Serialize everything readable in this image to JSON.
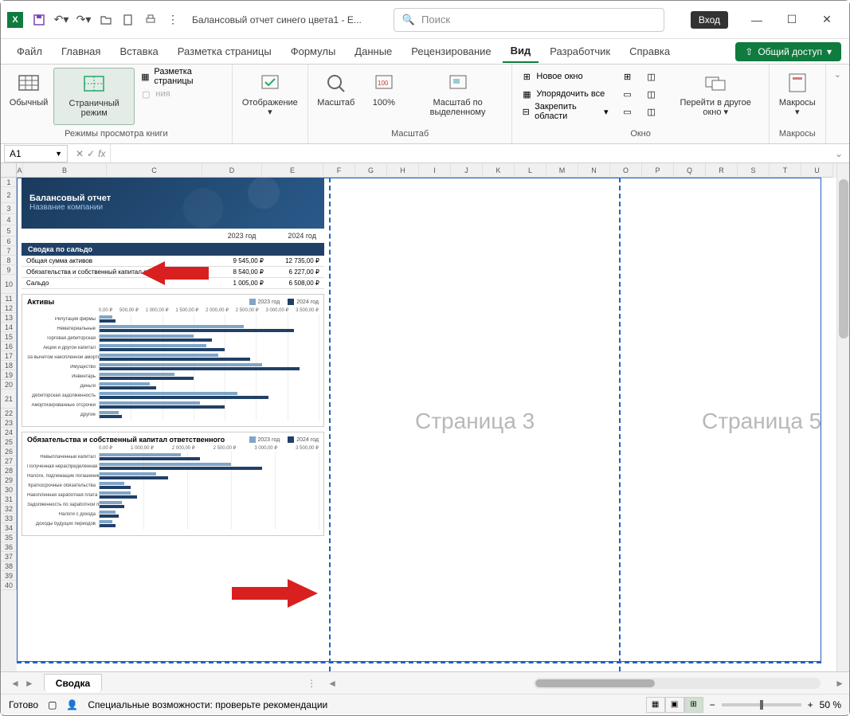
{
  "titlebar": {
    "doc_title": "Балансовый отчет синего цвета1 - E...",
    "search_placeholder": "Поиск",
    "login": "Вход"
  },
  "tabs": {
    "file": "Файл",
    "home": "Главная",
    "insert": "Вставка",
    "page_layout": "Разметка страницы",
    "formulas": "Формулы",
    "data": "Данные",
    "review": "Рецензирование",
    "view": "Вид",
    "developer": "Разработчик",
    "help": "Справка",
    "share": "Общий доступ"
  },
  "ribbon": {
    "normal": "Обычный",
    "page_break": "Страничный режим",
    "page_layout_btn": "Разметка страницы",
    "custom_views": "ния",
    "group_views": "Режимы просмотра книги",
    "show": "Отображение",
    "zoom": "Масштаб",
    "zoom100": "100%",
    "zoom_selection": "Масштаб по выделенному",
    "group_zoom": "Масштаб",
    "new_window": "Новое окно",
    "arrange": "Упорядочить все",
    "freeze": "Закрепить области",
    "group_window": "Окно",
    "switch": "Перейти в другое окно",
    "macros": "Макросы",
    "group_macros": "Макросы"
  },
  "namebox": "A1",
  "columns": [
    "A",
    "B",
    "C",
    "D",
    "E",
    "F",
    "G",
    "H",
    "I",
    "J",
    "K",
    "L",
    "M",
    "N",
    "O",
    "P",
    "Q",
    "R",
    "S",
    "T",
    "U"
  ],
  "rows": [
    "1",
    "2",
    "3",
    "4",
    "5",
    "6",
    "7",
    "8",
    "9",
    "10",
    "11",
    "12",
    "13",
    "14",
    "15",
    "16",
    "17",
    "18",
    "19",
    "20",
    "21",
    "22",
    "23",
    "24",
    "25",
    "26",
    "27",
    "28",
    "29",
    "30",
    "31",
    "32",
    "33",
    "34",
    "35",
    "36",
    "37",
    "38",
    "39",
    "40"
  ],
  "page_wm": {
    "p3": "Страница 3",
    "p5": "Страница 5"
  },
  "report": {
    "title": "Балансовый отчет",
    "subtitle": "Название компании",
    "year1": "2023 год",
    "year2": "2024 год",
    "section1": "Сводка по сальдо",
    "rows1": [
      {
        "l": "Общая сумма активов",
        "v1": "9 545,00 ₽",
        "v2": "12 735,00 ₽"
      },
      {
        "l": "Обязательства и собственный капитал ответственного, всего",
        "v1": "8 540,00 ₽",
        "v2": "6 227,00 ₽"
      },
      {
        "l": "Сальдо",
        "v1": "1 005,00 ₽",
        "v2": "6 508,00 ₽"
      }
    ],
    "chart1_title": "Активы",
    "chart2_title": "Обязательства и собственный капитал ответственного",
    "legend1": "2023 год",
    "legend2": "2024 год"
  },
  "chart_data": [
    {
      "type": "bar",
      "title": "Активы",
      "xlabel": "",
      "ylabel": "",
      "xlim": [
        0,
        3500
      ],
      "axis_ticks": [
        "0,00 ₽",
        "500,00 ₽",
        "1 000,00 ₽",
        "1 500,00 ₽",
        "2 000,00 ₽",
        "2 500,00 ₽",
        "3 000,00 ₽",
        "3 500,00 ₽"
      ],
      "categories": [
        "Репутация фирмы",
        "Нематериальные",
        "Торговая дебиторская",
        "Акции и другой капитал",
        "За вычетом накопленной амортизации",
        "Имущество",
        "Инвентарь",
        "Деньги",
        "Дебиторская задолженность",
        "Амортизированные отсрочки",
        "Другие"
      ],
      "series": [
        {
          "name": "2023 год",
          "values": [
            200,
            2300,
            1500,
            1700,
            1900,
            2600,
            1200,
            800,
            2200,
            1600,
            300
          ]
        },
        {
          "name": "2024 год",
          "values": [
            250,
            3100,
            1800,
            2000,
            2400,
            3200,
            1500,
            900,
            2700,
            2000,
            350
          ]
        }
      ]
    },
    {
      "type": "bar",
      "title": "Обязательства и собственный капитал ответственного",
      "xlabel": "",
      "ylabel": "",
      "xlim": [
        0,
        3500
      ],
      "axis_ticks": [
        "0,00 ₽",
        "1 000,00 ₽",
        "2 000,00 ₽",
        "2 500,00 ₽",
        "3 000,00 ₽",
        "3 500,00 ₽"
      ],
      "categories": [
        "Невыплаченный капитал",
        "Полученная нераспределённая прибыль",
        "Налоги, подлежащие погашению",
        "Краткосрочные обязательства",
        "Накопленная заработная плата",
        "Задолженность по заработной плате",
        "Налоги с дохода",
        "Доходы будущих периодов"
      ],
      "series": [
        {
          "name": "2023 год",
          "values": [
            1300,
            2100,
            900,
            400,
            500,
            350,
            250,
            200
          ]
        },
        {
          "name": "2024 год",
          "values": [
            1600,
            2600,
            1100,
            500,
            600,
            400,
            300,
            250
          ]
        }
      ]
    }
  ],
  "sheet_tab": "Сводка",
  "status": {
    "ready": "Готово",
    "accessibility": "Специальные возможности: проверьте рекомендации",
    "zoom": "50 %"
  }
}
